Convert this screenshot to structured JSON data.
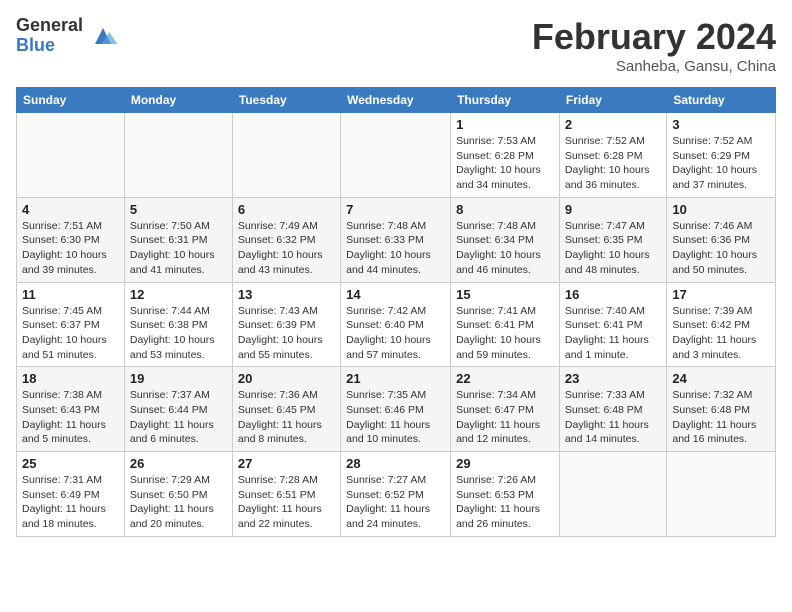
{
  "header": {
    "logo_general": "General",
    "logo_blue": "Blue",
    "title": "February 2024",
    "subtitle": "Sanheba, Gansu, China"
  },
  "weekdays": [
    "Sunday",
    "Monday",
    "Tuesday",
    "Wednesday",
    "Thursday",
    "Friday",
    "Saturday"
  ],
  "weeks": [
    [
      {
        "day": "",
        "info": ""
      },
      {
        "day": "",
        "info": ""
      },
      {
        "day": "",
        "info": ""
      },
      {
        "day": "",
        "info": ""
      },
      {
        "day": "1",
        "info": "Sunrise: 7:53 AM\nSunset: 6:28 PM\nDaylight: 10 hours\nand 34 minutes."
      },
      {
        "day": "2",
        "info": "Sunrise: 7:52 AM\nSunset: 6:28 PM\nDaylight: 10 hours\nand 36 minutes."
      },
      {
        "day": "3",
        "info": "Sunrise: 7:52 AM\nSunset: 6:29 PM\nDaylight: 10 hours\nand 37 minutes."
      }
    ],
    [
      {
        "day": "4",
        "info": "Sunrise: 7:51 AM\nSunset: 6:30 PM\nDaylight: 10 hours\nand 39 minutes."
      },
      {
        "day": "5",
        "info": "Sunrise: 7:50 AM\nSunset: 6:31 PM\nDaylight: 10 hours\nand 41 minutes."
      },
      {
        "day": "6",
        "info": "Sunrise: 7:49 AM\nSunset: 6:32 PM\nDaylight: 10 hours\nand 43 minutes."
      },
      {
        "day": "7",
        "info": "Sunrise: 7:48 AM\nSunset: 6:33 PM\nDaylight: 10 hours\nand 44 minutes."
      },
      {
        "day": "8",
        "info": "Sunrise: 7:48 AM\nSunset: 6:34 PM\nDaylight: 10 hours\nand 46 minutes."
      },
      {
        "day": "9",
        "info": "Sunrise: 7:47 AM\nSunset: 6:35 PM\nDaylight: 10 hours\nand 48 minutes."
      },
      {
        "day": "10",
        "info": "Sunrise: 7:46 AM\nSunset: 6:36 PM\nDaylight: 10 hours\nand 50 minutes."
      }
    ],
    [
      {
        "day": "11",
        "info": "Sunrise: 7:45 AM\nSunset: 6:37 PM\nDaylight: 10 hours\nand 51 minutes."
      },
      {
        "day": "12",
        "info": "Sunrise: 7:44 AM\nSunset: 6:38 PM\nDaylight: 10 hours\nand 53 minutes."
      },
      {
        "day": "13",
        "info": "Sunrise: 7:43 AM\nSunset: 6:39 PM\nDaylight: 10 hours\nand 55 minutes."
      },
      {
        "day": "14",
        "info": "Sunrise: 7:42 AM\nSunset: 6:40 PM\nDaylight: 10 hours\nand 57 minutes."
      },
      {
        "day": "15",
        "info": "Sunrise: 7:41 AM\nSunset: 6:41 PM\nDaylight: 10 hours\nand 59 minutes."
      },
      {
        "day": "16",
        "info": "Sunrise: 7:40 AM\nSunset: 6:41 PM\nDaylight: 11 hours\nand 1 minute."
      },
      {
        "day": "17",
        "info": "Sunrise: 7:39 AM\nSunset: 6:42 PM\nDaylight: 11 hours\nand 3 minutes."
      }
    ],
    [
      {
        "day": "18",
        "info": "Sunrise: 7:38 AM\nSunset: 6:43 PM\nDaylight: 11 hours\nand 5 minutes."
      },
      {
        "day": "19",
        "info": "Sunrise: 7:37 AM\nSunset: 6:44 PM\nDaylight: 11 hours\nand 6 minutes."
      },
      {
        "day": "20",
        "info": "Sunrise: 7:36 AM\nSunset: 6:45 PM\nDaylight: 11 hours\nand 8 minutes."
      },
      {
        "day": "21",
        "info": "Sunrise: 7:35 AM\nSunset: 6:46 PM\nDaylight: 11 hours\nand 10 minutes."
      },
      {
        "day": "22",
        "info": "Sunrise: 7:34 AM\nSunset: 6:47 PM\nDaylight: 11 hours\nand 12 minutes."
      },
      {
        "day": "23",
        "info": "Sunrise: 7:33 AM\nSunset: 6:48 PM\nDaylight: 11 hours\nand 14 minutes."
      },
      {
        "day": "24",
        "info": "Sunrise: 7:32 AM\nSunset: 6:48 PM\nDaylight: 11 hours\nand 16 minutes."
      }
    ],
    [
      {
        "day": "25",
        "info": "Sunrise: 7:31 AM\nSunset: 6:49 PM\nDaylight: 11 hours\nand 18 minutes."
      },
      {
        "day": "26",
        "info": "Sunrise: 7:29 AM\nSunset: 6:50 PM\nDaylight: 11 hours\nand 20 minutes."
      },
      {
        "day": "27",
        "info": "Sunrise: 7:28 AM\nSunset: 6:51 PM\nDaylight: 11 hours\nand 22 minutes."
      },
      {
        "day": "28",
        "info": "Sunrise: 7:27 AM\nSunset: 6:52 PM\nDaylight: 11 hours\nand 24 minutes."
      },
      {
        "day": "29",
        "info": "Sunrise: 7:26 AM\nSunset: 6:53 PM\nDaylight: 11 hours\nand 26 minutes."
      },
      {
        "day": "",
        "info": ""
      },
      {
        "day": "",
        "info": ""
      }
    ]
  ]
}
